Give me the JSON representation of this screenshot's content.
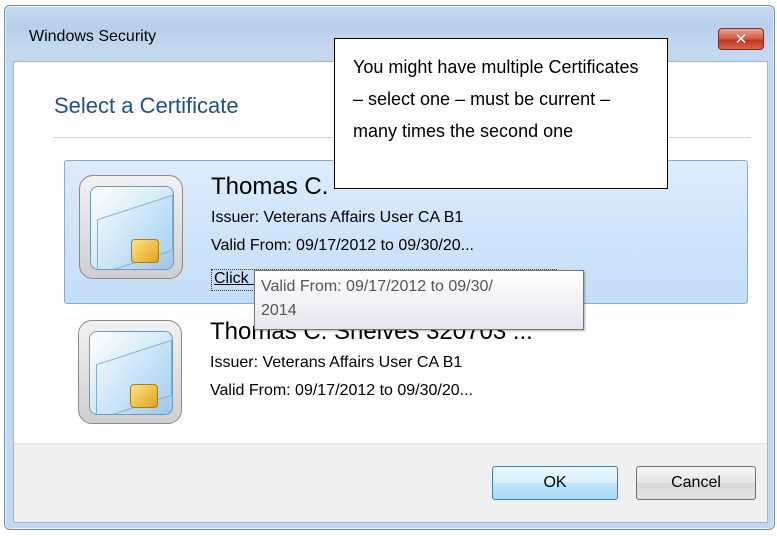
{
  "window": {
    "title": "Windows Security",
    "close_label": "✕"
  },
  "dialog": {
    "heading": "Select a Certificate"
  },
  "certificates": [
    {
      "name": "Thomas C.",
      "issuer": "Issuer: Veterans Affairs User CA B1",
      "valid": "Valid From: 09/17/2012 to 09/30/20...",
      "link": "Click h",
      "selected": true
    },
    {
      "name": "Thomas C. Shelves 320703 ...",
      "issuer": "Issuer: Veterans Affairs User CA B1",
      "valid": "Valid From: 09/17/2012 to 09/30/20...",
      "selected": false
    }
  ],
  "tooltip": {
    "line1": "Valid From: 09/17/2012 to 09/30/",
    "line2": "2014"
  },
  "callout": {
    "text": "You might have multiple Certificates – select one – must be current – many times the second one"
  },
  "buttons": {
    "ok": "OK",
    "cancel": "Cancel"
  },
  "colors": {
    "heading": "#1d4f91",
    "selection": "#c4ddf7",
    "close": "#c0351e"
  },
  "icons": {
    "certificate": "smart-card-icon",
    "close": "close-icon"
  }
}
